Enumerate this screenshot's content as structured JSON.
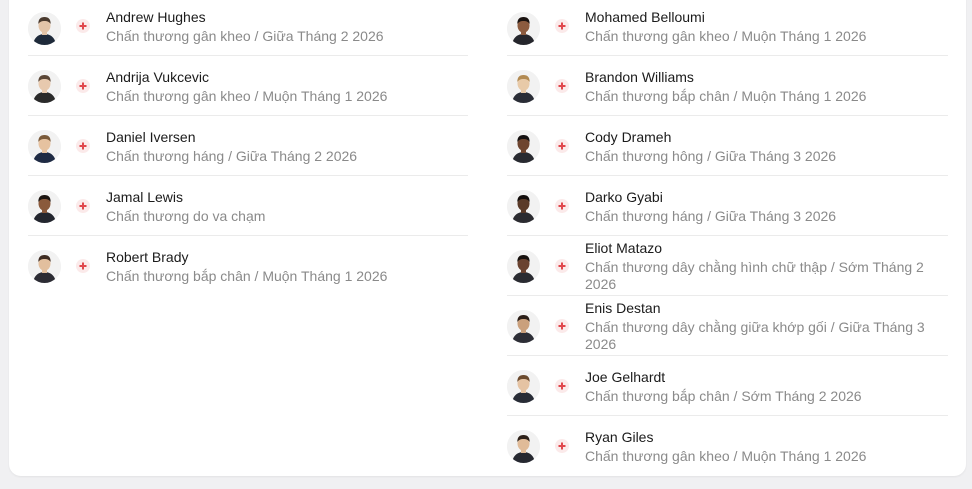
{
  "colors": {
    "injury_icon": "#e0474c",
    "name_text": "#1b1b1b",
    "detail_text": "#8a8a8a"
  },
  "left_players": [
    {
      "name": "Andrew Hughes",
      "detail": "Chấn thương gân kheo / Giữa Tháng 2 2026"
    },
    {
      "name": "Andrija Vukcevic",
      "detail": "Chấn thương gân kheo / Muộn Tháng 1 2026"
    },
    {
      "name": "Daniel Iversen",
      "detail": "Chấn thương háng / Giữa Tháng 2 2026"
    },
    {
      "name": "Jamal Lewis",
      "detail": "Chấn thương do va chạm"
    },
    {
      "name": "Robert Brady",
      "detail": "Chấn thương bắp chân / Muộn Tháng 1 2026"
    }
  ],
  "right_players": [
    {
      "name": "Mohamed Belloumi",
      "detail": "Chấn thương gân kheo / Muộn Tháng 1 2026"
    },
    {
      "name": "Brandon Williams",
      "detail": "Chấn thương bắp chân / Muộn Tháng 1 2026"
    },
    {
      "name": "Cody Drameh",
      "detail": "Chấn thương hông / Giữa Tháng 3 2026"
    },
    {
      "name": "Darko Gyabi",
      "detail": "Chấn thương háng / Giữa Tháng 3 2026"
    },
    {
      "name": "Eliot Matazo",
      "detail": "Chấn thương dây chằng hình chữ thập / Sớm Tháng 2 2026"
    },
    {
      "name": "Enis Destan",
      "detail": "Chấn thương dây chằng giữa khớp gối / Giữa Tháng 3 2026"
    },
    {
      "name": "Joe Gelhardt",
      "detail": "Chấn thương bắp chân / Sớm Tháng 2 2026"
    },
    {
      "name": "Ryan Giles",
      "detail": "Chấn thương gân kheo / Muộn Tháng 1 2026"
    }
  ]
}
